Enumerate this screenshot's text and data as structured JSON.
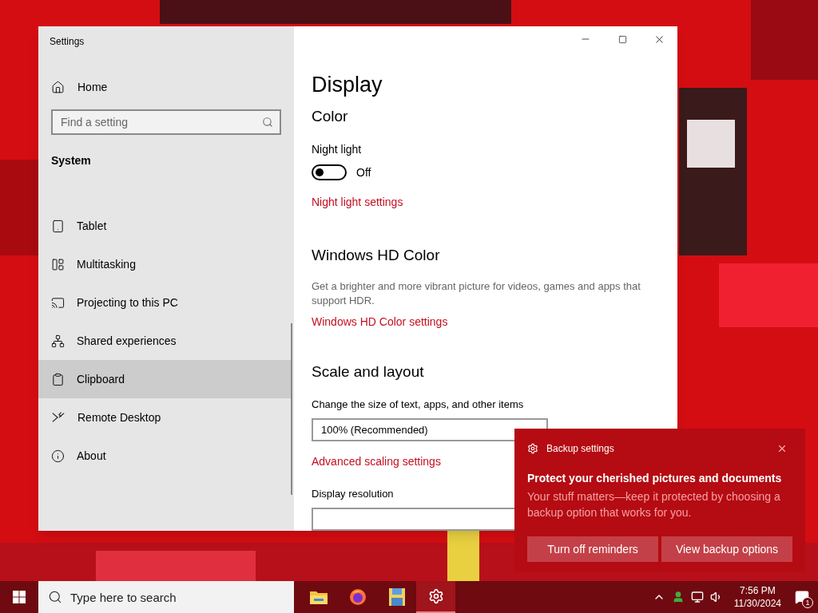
{
  "window": {
    "title": "Settings"
  },
  "sidebar": {
    "home": "Home",
    "search": {
      "placeholder": "Find a setting"
    },
    "section": "System",
    "items": [
      {
        "label": "Tablet",
        "selected": false
      },
      {
        "label": "Multitasking",
        "selected": false
      },
      {
        "label": "Projecting to this PC",
        "selected": false
      },
      {
        "label": "Shared experiences",
        "selected": false
      },
      {
        "label": "Clipboard",
        "selected": true
      },
      {
        "label": "Remote Desktop",
        "selected": false
      },
      {
        "label": "About",
        "selected": false
      }
    ]
  },
  "main": {
    "title": "Display",
    "color": {
      "heading": "Color",
      "night_light": {
        "label": "Night light",
        "on": false,
        "state_text": "Off"
      },
      "link": "Night light settings"
    },
    "hdr": {
      "heading": "Windows HD Color",
      "description": "Get a brighter and more vibrant picture for videos, games and apps that support HDR.",
      "link": "Windows HD Color settings"
    },
    "scale": {
      "heading": "Scale and layout",
      "size_label": "Change the size of text, apps, and other items",
      "size_value": "100% (Recommended)",
      "link": "Advanced scaling settings",
      "resolution_label": "Display resolution"
    }
  },
  "toast": {
    "app": "Backup settings",
    "title": "Protect your cherished pictures and documents",
    "body": "Your stuff matters—keep it protected by choosing a backup option that works for you.",
    "buttons": [
      "Turn off reminders",
      "View backup options"
    ]
  },
  "taskbar": {
    "search": {
      "placeholder": "Type here to search"
    },
    "apps": [
      {
        "active": false
      },
      {
        "active": false
      },
      {
        "active": false
      },
      {
        "active": true
      }
    ],
    "time": "7:56 PM",
    "date": "11/30/2024",
    "notification_count": "1"
  }
}
